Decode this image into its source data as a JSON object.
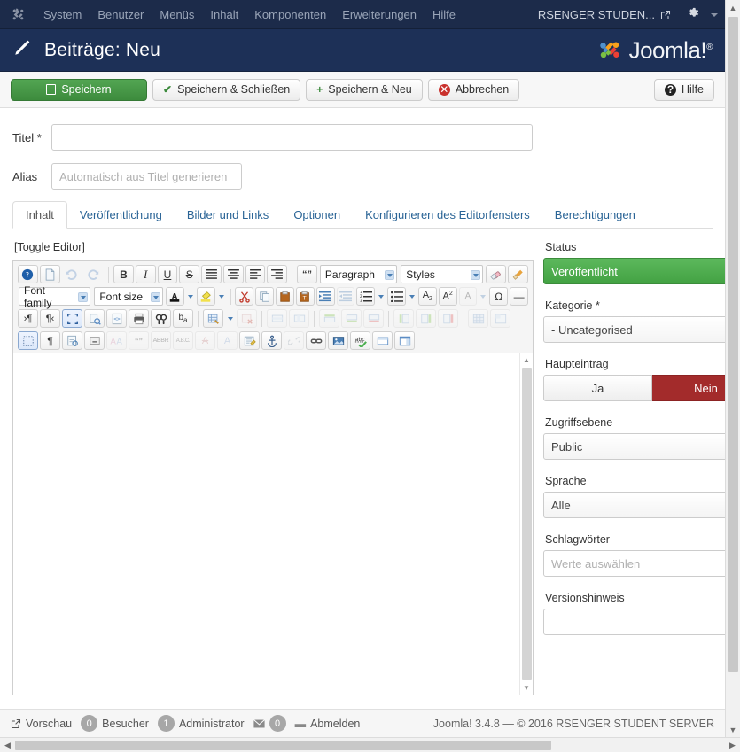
{
  "topbar": {
    "logo_icon": "joomla-logo-icon",
    "menu": [
      {
        "label": "System"
      },
      {
        "label": "Benutzer"
      },
      {
        "label": "Menüs"
      },
      {
        "label": "Inhalt"
      },
      {
        "label": "Komponenten"
      },
      {
        "label": "Erweiterungen"
      },
      {
        "label": "Hilfe"
      }
    ],
    "site_name": "RSENGER STUDEN...",
    "external_link_icon": "external-link-icon",
    "gear_icon": "gear-icon",
    "caret_icon": "chevron-down-icon"
  },
  "subheader": {
    "icon": "pencil-icon",
    "title": "Beiträge: Neu",
    "brand": "Joomla!",
    "brand_sup": "®"
  },
  "toolbar": {
    "save_label": "Speichern",
    "save_close_label": "Speichern & Schließen",
    "save_new_label": "Speichern & Neu",
    "cancel_label": "Abbrechen",
    "help_label": "Hilfe"
  },
  "form": {
    "title_label": "Titel",
    "title_required": "*",
    "title_value": "",
    "title_placeholder": "",
    "alias_label": "Alias",
    "alias_value": "",
    "alias_placeholder": "Automatisch aus Titel generieren"
  },
  "tabs": [
    {
      "label": "Inhalt",
      "active": true
    },
    {
      "label": "Veröffentlichung",
      "active": false
    },
    {
      "label": "Bilder und Links",
      "active": false
    },
    {
      "label": "Optionen",
      "active": false
    },
    {
      "label": "Konfigurieren des Editorfensters",
      "active": false
    },
    {
      "label": "Berechtigungen",
      "active": false
    }
  ],
  "editor": {
    "toggle_label": "[Toggle Editor]",
    "content": "",
    "selects": {
      "paragraph": "Paragraph",
      "styles": "Styles",
      "font_family": "Font family",
      "font_size": "Font size"
    },
    "rows": [
      {
        "buttons": [
          {
            "name": "help-icon",
            "state": "box"
          },
          {
            "name": "new-document-icon",
            "state": "box"
          },
          {
            "name": "undo-icon",
            "state": "dis"
          },
          {
            "name": "redo-icon",
            "state": "dis"
          },
          {
            "name": "sep"
          },
          {
            "name": "bold-icon",
            "state": "box"
          },
          {
            "name": "italic-icon",
            "state": "box"
          },
          {
            "name": "underline-icon",
            "state": "box"
          },
          {
            "name": "strikethrough-icon",
            "state": "box"
          },
          {
            "name": "align-justify-icon",
            "state": "box"
          },
          {
            "name": "align-center-icon",
            "state": "box"
          },
          {
            "name": "align-left-icon",
            "state": "box"
          },
          {
            "name": "align-right-icon",
            "state": "box"
          },
          {
            "name": "sep"
          },
          {
            "name": "blockquote-icon",
            "state": "box"
          }
        ]
      }
    ]
  },
  "sidebar": {
    "status": {
      "label": "Status",
      "value": "Veröffentlicht"
    },
    "category": {
      "label": "Kategorie",
      "required": "*",
      "value": "- Uncategorised"
    },
    "featured": {
      "label": "Haupteintrag",
      "yes": "Ja",
      "no": "Nein",
      "selected": "Nein"
    },
    "access": {
      "label": "Zugriffsebene",
      "value": "Public"
    },
    "language": {
      "label": "Sprache",
      "value": "Alle"
    },
    "tags": {
      "label": "Schlagwörter",
      "placeholder": "Werte auswählen",
      "value": ""
    },
    "version_note": {
      "label": "Versionshinweis",
      "value": ""
    }
  },
  "statusbar": {
    "preview_icon": "external-link-icon",
    "preview_label": "Vorschau",
    "visitors_count": "0",
    "visitors_label": "Besucher",
    "admins_count": "1",
    "admins_label": "Administrator",
    "messages_icon": "envelope-icon",
    "messages_count": "0",
    "logout_label": "Abmelden",
    "copyright": "Joomla! 3.4.8  —  © 2016 RSENGER STUDENT SERVER"
  },
  "colors": {
    "topbar_bg": "#1c2b4a",
    "subheader_bg": "#1d3057",
    "primary_green": "#43a047",
    "danger_red": "#a32b2b",
    "link_blue": "#2a6496"
  }
}
